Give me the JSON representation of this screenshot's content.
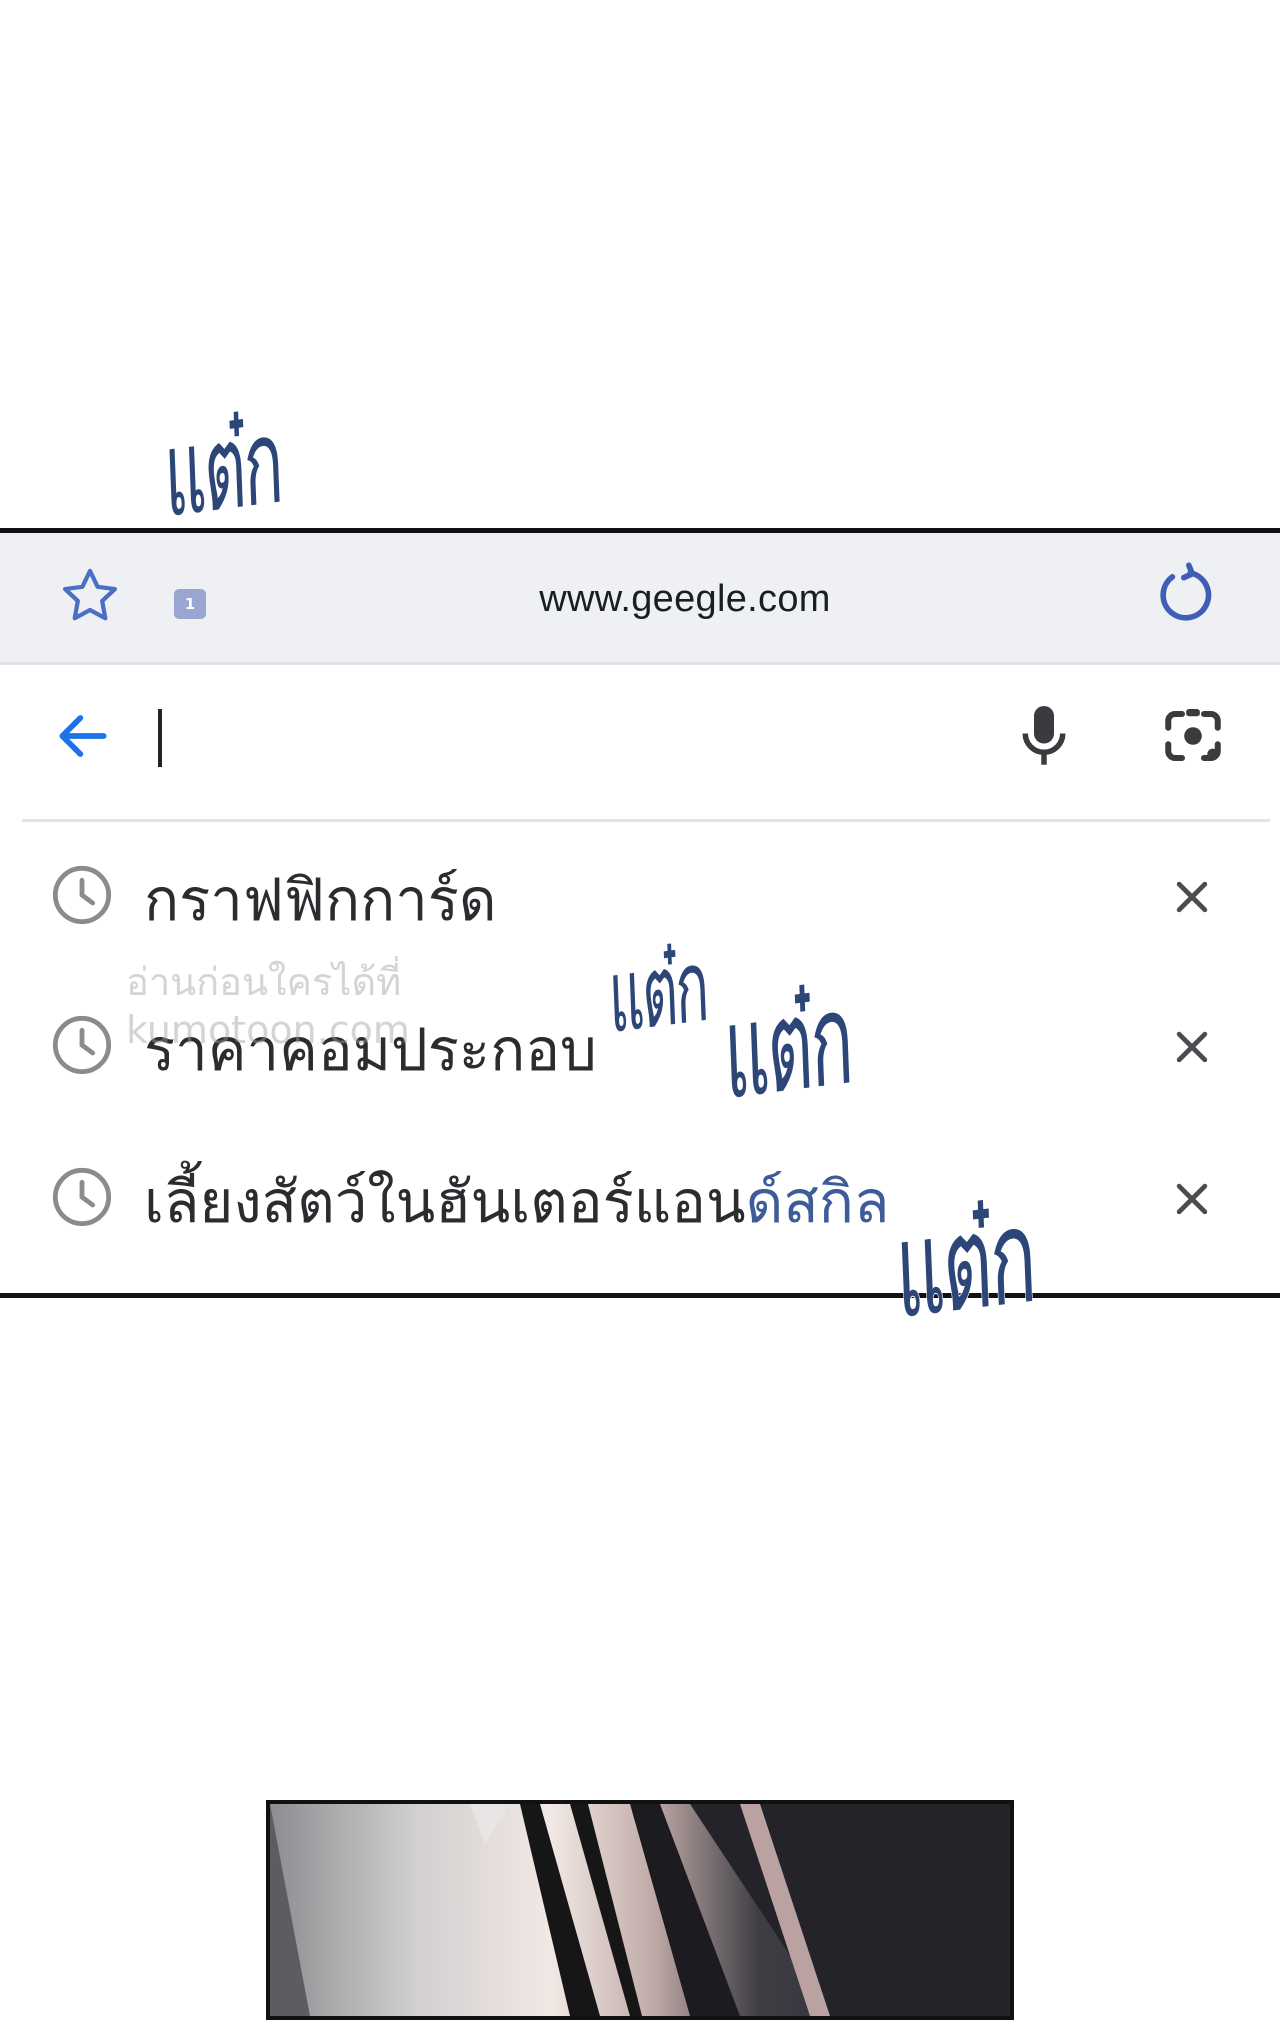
{
  "browser": {
    "url": "www.geegle.com",
    "tab_count": "1",
    "icons": {
      "bookmark": "star-icon",
      "reload": "reload-icon",
      "back": "back-arrow-icon",
      "voice": "mic-icon",
      "camera": "lens-icon"
    }
  },
  "history": [
    {
      "text": "กราฟฟิกการ์ด",
      "highlight": ""
    },
    {
      "text": "ราคาคอมประกอบ",
      "highlight": ""
    },
    {
      "text": "เลี้ยงสัตว์ในฮันเตอร์แอน",
      "highlight": "ด์สกิล"
    }
  ],
  "sfx": [
    "แต๋ก",
    "แต๋ก",
    "แต๋ก",
    "แต๋ก"
  ],
  "watermark": "อ่านก่อนใครได้ที่\nkumotoon.com",
  "colors": {
    "accent": "#1a73e8",
    "icon_blue": "#3f5fb7",
    "sfx": "#2d4678"
  }
}
